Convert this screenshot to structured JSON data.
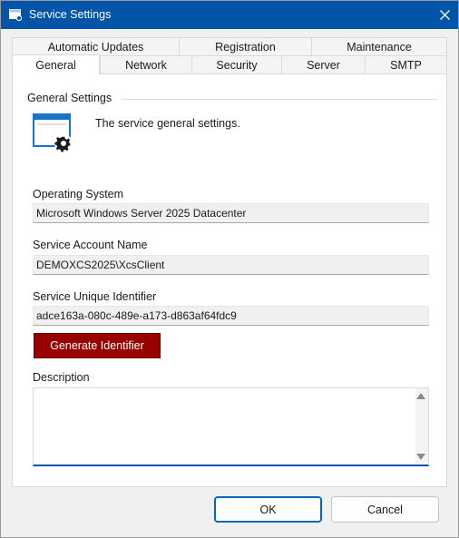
{
  "window": {
    "title": "Service Settings"
  },
  "tabs": {
    "row_back": [
      {
        "label": "Automatic Updates"
      },
      {
        "label": "Registration"
      },
      {
        "label": "Maintenance"
      }
    ],
    "row_front": [
      {
        "label": "General"
      },
      {
        "label": "Network"
      },
      {
        "label": "Security"
      },
      {
        "label": "Server"
      },
      {
        "label": "SMTP"
      }
    ],
    "selected": "General"
  },
  "general": {
    "group_title": "General Settings",
    "description_text": "The service general settings.",
    "icon": "window-gear-icon",
    "os_label": "Operating System",
    "os_value": "Microsoft Windows Server 2025 Datacenter",
    "account_label": "Service Account Name",
    "account_value": "DEMOXCS2025\\XcsClient",
    "identifier_label": "Service Unique Identifier",
    "identifier_value": "adce163a-080c-489e-a173-d863af64fdc9",
    "generate_button": "Generate Identifier",
    "description_label": "Description",
    "description_value": ""
  },
  "buttons": {
    "ok": "OK",
    "cancel": "Cancel"
  },
  "colors": {
    "titlebar": "#0055a8",
    "generate_button": "#980000",
    "focus_accent": "#0055a8"
  }
}
